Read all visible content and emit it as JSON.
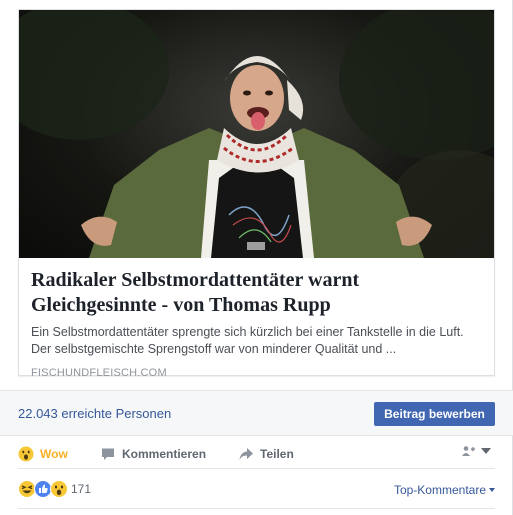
{
  "link_preview": {
    "image_subject": "photo",
    "title": "Radikaler Selbstmordattentäter warnt Gleichgesinnte - von Thomas Rupp",
    "description": "Ein Selbstmordattentäter sprengte sich kürzlich bei einer Tankstelle in die Luft. Der selbstgemischte Sprengstoff war von minderer Qualität und ...",
    "domain": "FISCHUNDFLEISCH.COM"
  },
  "insights": {
    "reach_text": "22.043 erreichte Personen",
    "boost_label": "Beitrag bewerben"
  },
  "actions": {
    "wow_label": "Wow",
    "comment_label": "Kommentieren",
    "share_label": "Teilen",
    "audience_icon": "friends-of-friends-icon"
  },
  "reactions": {
    "icons": [
      "haha-icon",
      "like-icon",
      "wow-icon"
    ],
    "count": "171",
    "sort_label": "Top-Kommentare"
  },
  "colors": {
    "link_blue": "#365899",
    "button_blue": "#4267b2",
    "wow_yellow": "#f7b125",
    "muted_gray": "#606770"
  }
}
